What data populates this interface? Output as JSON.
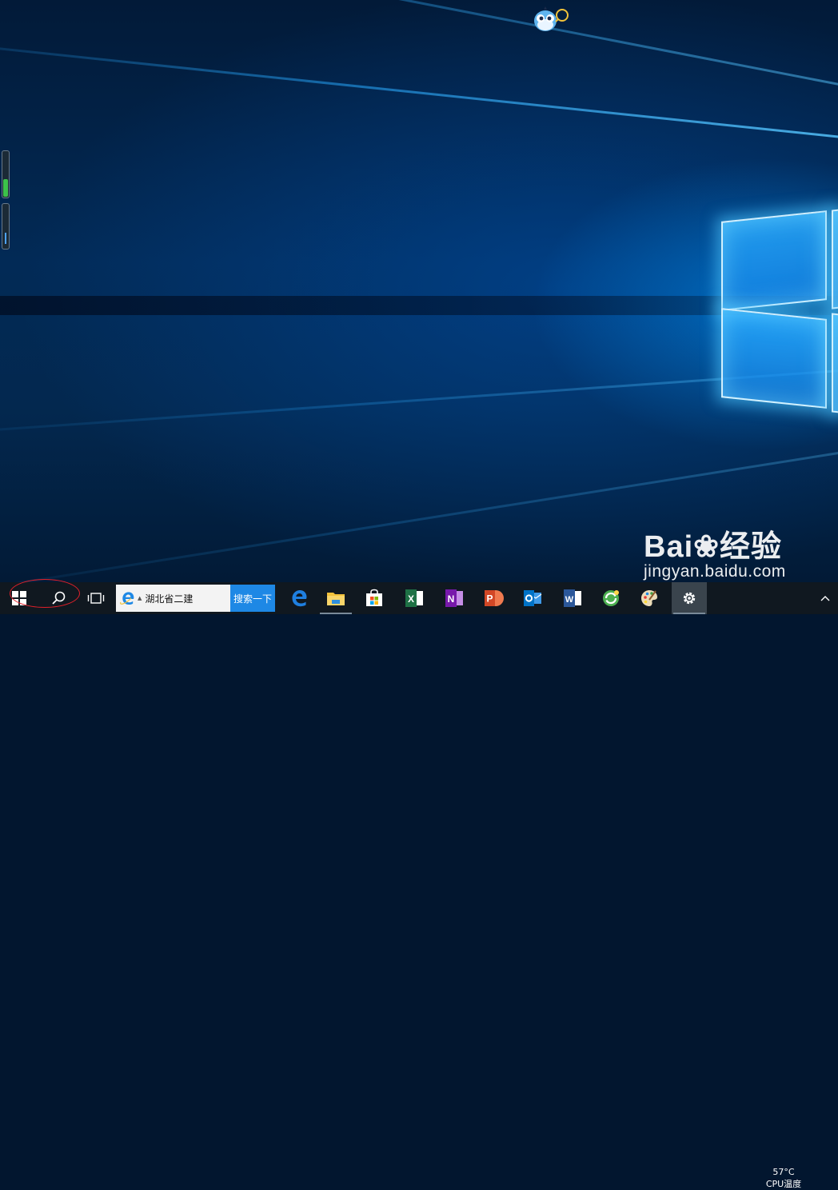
{
  "desktop": {
    "wallpaper": "windows-10-hero",
    "gadget_icon": "bird-mascot-icon"
  },
  "watermark": {
    "logo": "Bai❀经验",
    "url": "jingyan.baidu.com"
  },
  "taskbar": {
    "start_icon": "windows-logo-icon",
    "search_icon": "search-icon",
    "task_view_icon": "task-view-icon",
    "search_box": {
      "text": "湖北省二建",
      "button_label": "搜索一下"
    },
    "apps": [
      {
        "name": "edge",
        "icon": "edge-icon",
        "color": "#1f7fe0",
        "running": false
      },
      {
        "name": "file-explorer",
        "icon": "folder-icon",
        "color": "#f3c23b",
        "running": true
      },
      {
        "name": "store",
        "icon": "store-icon",
        "color": "#ffffff",
        "running": false
      },
      {
        "name": "excel",
        "icon": "excel-icon",
        "color": "#1e7145",
        "running": false
      },
      {
        "name": "onenote",
        "icon": "onenote-icon",
        "color": "#7719aa",
        "running": false
      },
      {
        "name": "powerpoint",
        "icon": "powerpoint-icon",
        "color": "#d24726",
        "running": false
      },
      {
        "name": "outlook",
        "icon": "outlook-icon",
        "color": "#0072c6",
        "running": false
      },
      {
        "name": "word",
        "icon": "word-icon",
        "color": "#2b579a",
        "running": false
      },
      {
        "name": "360-browser",
        "icon": "360-browser-icon",
        "color": "#4caf50",
        "running": false
      },
      {
        "name": "paint",
        "icon": "paint-palette-icon",
        "color": "#e8d6b0",
        "running": false
      },
      {
        "name": "settings",
        "icon": "gear-icon",
        "color": "#ffffff",
        "running": true
      }
    ],
    "tray": {
      "cpu_temp": "57°C",
      "cpu_label": "CPU温度",
      "chevron_icon": "chevron-up-icon"
    }
  },
  "annotation_color": "#e0202a"
}
